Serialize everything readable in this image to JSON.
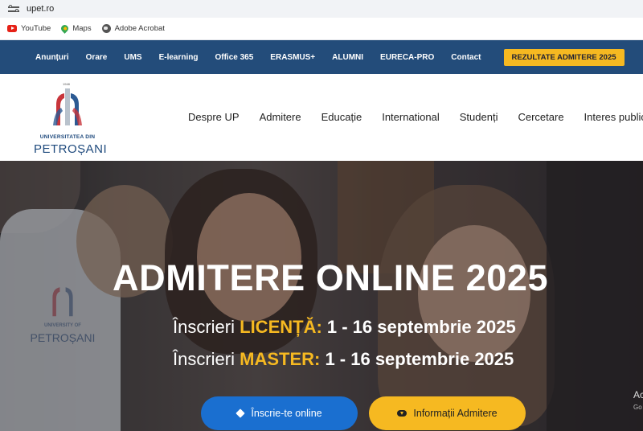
{
  "browser": {
    "url": "upet.ro"
  },
  "bookmarks": [
    {
      "label": "YouTube",
      "icon": "youtube-icon"
    },
    {
      "label": "Maps",
      "icon": "maps-pin-icon"
    },
    {
      "label": "Adobe Acrobat",
      "icon": "globe-icon"
    }
  ],
  "topnav": {
    "items": [
      "Anunțuri",
      "Orare",
      "UMS",
      "E-learning",
      "Office 365",
      "ERASMUS+",
      "ALUMNI",
      "EURECA-PRO",
      "Contact"
    ],
    "cta": "REZULTATE ADMITERE 2025"
  },
  "logo": {
    "year": "1948",
    "line1": "UNIVERSITATEA DIN",
    "line2": "PETROȘANI"
  },
  "mainnav": [
    "Despre UP",
    "Admitere",
    "Educație",
    "International",
    "Studenți",
    "Cercetare",
    "Interes public"
  ],
  "hero": {
    "title": "ADMITERE ONLINE 2025",
    "shirt_line1": "UNIVERSITY OF",
    "shirt_line2": "PETROȘANI",
    "line1": {
      "prefix": "Înscrieri ",
      "key": "LICENȚĂ:",
      "dates": " 1 - 16 septembrie 2025"
    },
    "line2": {
      "prefix": "Înscrieri ",
      "key": "MASTER:",
      "dates": " 1 - 16 septembrie 2025"
    },
    "button_primary": "Înscrie-te online",
    "button_secondary": "Informații Admitere",
    "recaptcha_a": "Ac",
    "recaptcha_b": "Go"
  },
  "colors": {
    "topnav": "#234c7a",
    "accent": "#f6b921",
    "primary_button": "#1a6fd0"
  }
}
